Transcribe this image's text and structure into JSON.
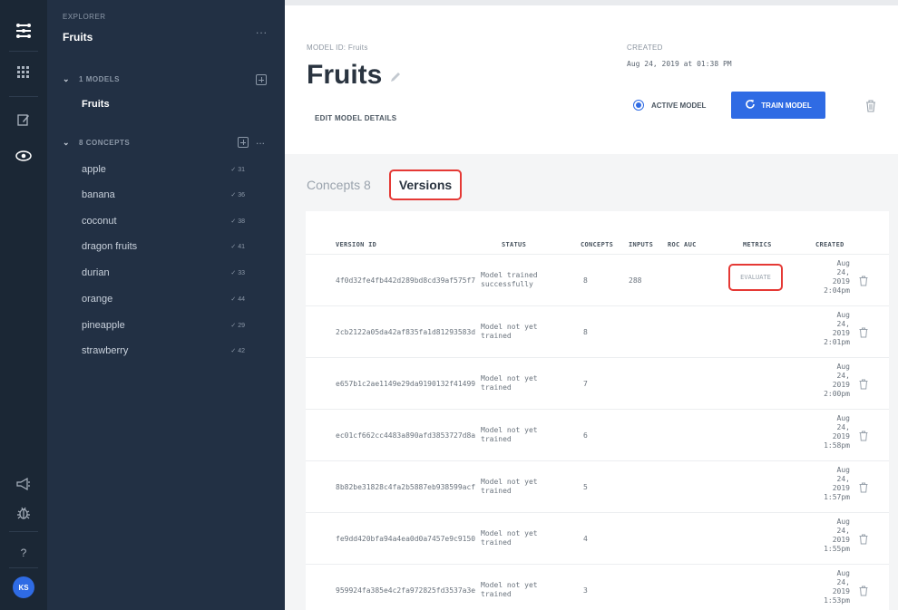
{
  "rail": {
    "icons": [
      "app-logo-icon",
      "apps-grid-icon",
      "edit-icon",
      "eye-icon",
      "announcement-icon",
      "bug-icon",
      "help-icon"
    ],
    "help_label": "?",
    "avatar": "KS"
  },
  "explorer": {
    "label": "EXPLORER",
    "title": "Fruits",
    "menu": "...",
    "models_header": "1 MODELS",
    "models": [
      "Fruits"
    ],
    "concepts_header": "8 CONCEPTS",
    "concepts_menu": "...",
    "concepts": [
      {
        "name": "apple",
        "count": "✓ 31"
      },
      {
        "name": "banana",
        "count": "✓ 36"
      },
      {
        "name": "coconut",
        "count": "✓ 38"
      },
      {
        "name": "dragon fruits",
        "count": "✓ 41"
      },
      {
        "name": "durian",
        "count": "✓ 33"
      },
      {
        "name": "orange",
        "count": "✓ 44"
      },
      {
        "name": "pineapple",
        "count": "✓ 29"
      },
      {
        "name": "strawberry",
        "count": "✓ 42"
      }
    ]
  },
  "header": {
    "model_id_label": "MODEL ID: Fruits",
    "title": "Fruits",
    "edit_details": "EDIT MODEL DETAILS",
    "created_label": "CREATED",
    "created_value": "Aug 24, 2019 at 01:38 PM",
    "active_model": "ACTIVE MODEL",
    "train_model": "TRAIN MODEL"
  },
  "tabs": {
    "concepts": "Concepts 8",
    "versions": "Versions"
  },
  "table": {
    "headers": {
      "version_id": "VERSION ID",
      "status": "STATUS",
      "concepts": "CONCEPTS",
      "inputs": "INPUTS",
      "roc_auc": "ROC AUC",
      "metrics": "METRICS",
      "created": "CREATED"
    },
    "evaluate": "EVALUATE",
    "rows": [
      {
        "id": "4f0d32fe4fb442d289bd8cd39af575f7",
        "status": "Model trained successfully",
        "concepts": "8",
        "inputs": "288",
        "c1": "Aug",
        "c2": "24,",
        "c3": "2019",
        "c4": "2:04pm"
      },
      {
        "id": "2cb2122a05da42af835fa1d81293583d",
        "status": "Model not yet trained",
        "concepts": "8",
        "inputs": "",
        "c1": "Aug",
        "c2": "24,",
        "c3": "2019",
        "c4": "2:01pm"
      },
      {
        "id": "e657b1c2ae1149e29da9190132f41499",
        "status": "Model not yet trained",
        "concepts": "7",
        "inputs": "",
        "c1": "Aug",
        "c2": "24,",
        "c3": "2019",
        "c4": "2:00pm"
      },
      {
        "id": "ec01cf662cc4483a890afd3853727d8a",
        "status": "Model not yet trained",
        "concepts": "6",
        "inputs": "",
        "c1": "Aug",
        "c2": "24,",
        "c3": "2019",
        "c4": "1:58pm"
      },
      {
        "id": "8b82be31828c4fa2b5887eb938599acf",
        "status": "Model not yet trained",
        "concepts": "5",
        "inputs": "",
        "c1": "Aug",
        "c2": "24,",
        "c3": "2019",
        "c4": "1:57pm"
      },
      {
        "id": "fe9dd420bfa94a4ea0d0a7457e9c9150",
        "status": "Model not yet trained",
        "concepts": "4",
        "inputs": "",
        "c1": "Aug",
        "c2": "24,",
        "c3": "2019",
        "c4": "1:55pm"
      },
      {
        "id": "959924fa385e4c2fa972825fd3537a3e",
        "status": "Model not yet trained",
        "concepts": "3",
        "inputs": "",
        "c1": "Aug",
        "c2": "24,",
        "c3": "2019",
        "c4": "1:53pm"
      }
    ]
  },
  "colors": {
    "rail_bg": "#1b2735",
    "sidebar_bg": "#223044",
    "accent": "#2f6be4",
    "highlight": "#e53935"
  }
}
